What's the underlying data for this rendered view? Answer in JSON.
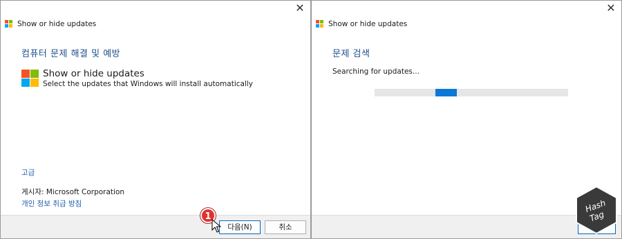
{
  "left_window": {
    "title": "Show or hide updates",
    "heading": "컴퓨터 문제 해결 및 예방",
    "product_name": "Show or hide updates",
    "product_description": "Select the updates that Windows will install automatically",
    "advanced_link": "고급",
    "publisher_label": "게시자:",
    "publisher_name": "Microsoft Corporation",
    "privacy_link": "개인 정보 취급 방침",
    "next_button": "다음(N)",
    "cancel_button": "취소",
    "callout_number": "1"
  },
  "right_window": {
    "title": "Show or hide updates",
    "heading": "문제 검색",
    "status": "Searching for updates..."
  },
  "watermark": {
    "line1": "Hash",
    "line2": "Tag"
  },
  "colors": {
    "heading": "#1f4e8c",
    "link": "#1f5fb0",
    "progress": "#0a78d7",
    "callout": "#e0322f"
  }
}
